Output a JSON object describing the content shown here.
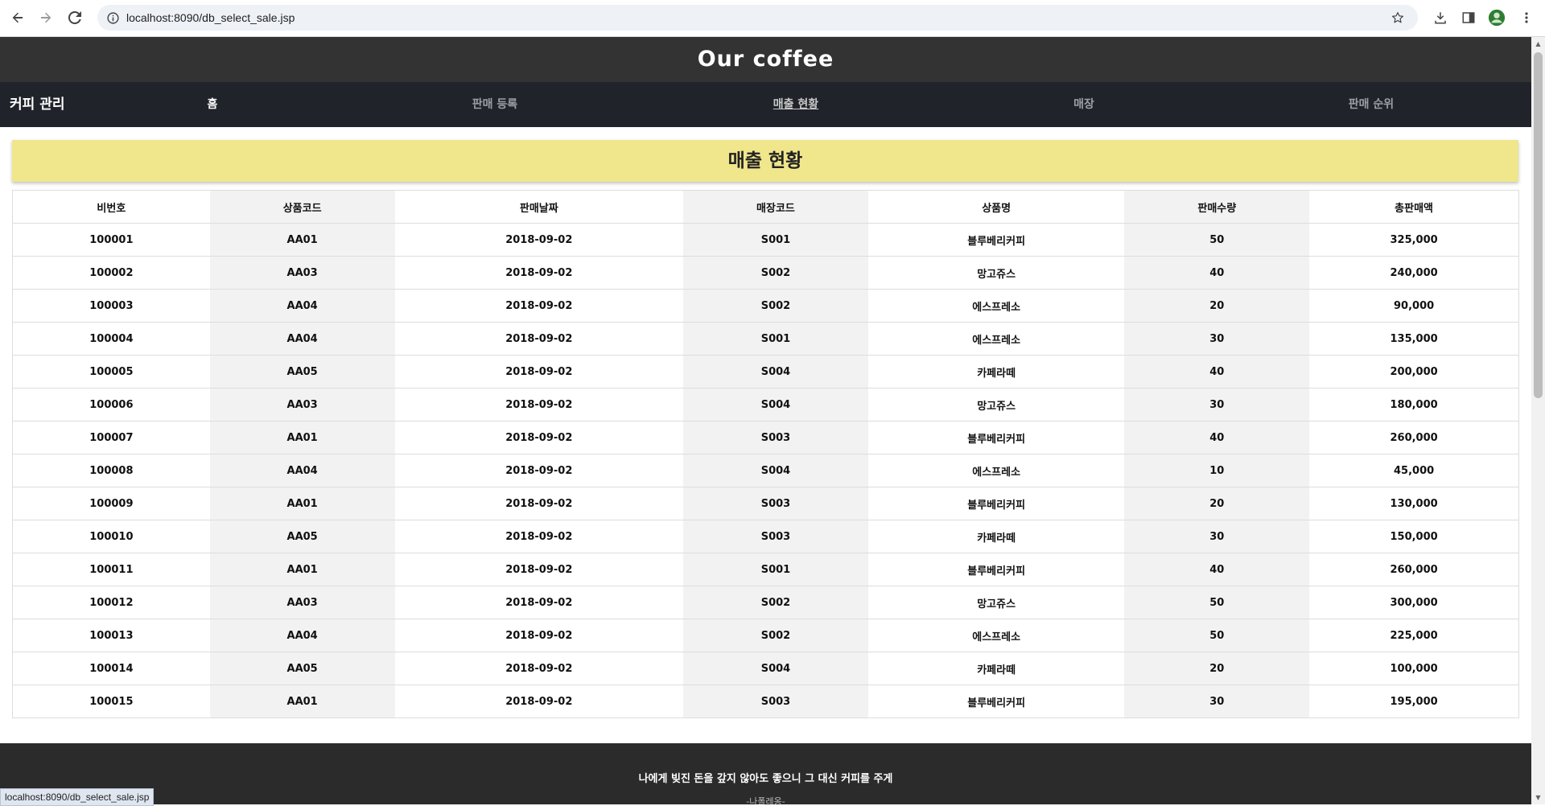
{
  "browser": {
    "url": "localhost:8090/db_select_sale.jsp",
    "status_url": "localhost:8090/db_select_sale.jsp"
  },
  "site": {
    "title": "Our coffee",
    "brand": "커피 관리",
    "nav": [
      "홈",
      "판매 등록",
      "매출 현황",
      "매장",
      "판매 순위"
    ],
    "active_nav": "매출 현황"
  },
  "banner": "매출 현황",
  "table": {
    "headers": [
      "비번호",
      "상품코드",
      "판매날짜",
      "매장코드",
      "상품명",
      "판매수량",
      "총판매액"
    ],
    "rows": [
      [
        "100001",
        "AA01",
        "2018-09-02",
        "S001",
        "블루베리커피",
        "50",
        "325,000"
      ],
      [
        "100002",
        "AA03",
        "2018-09-02",
        "S002",
        "망고쥬스",
        "40",
        "240,000"
      ],
      [
        "100003",
        "AA04",
        "2018-09-02",
        "S002",
        "에스프레소",
        "20",
        "90,000"
      ],
      [
        "100004",
        "AA04",
        "2018-09-02",
        "S001",
        "에스프레소",
        "30",
        "135,000"
      ],
      [
        "100005",
        "AA05",
        "2018-09-02",
        "S004",
        "카페라떼",
        "40",
        "200,000"
      ],
      [
        "100006",
        "AA03",
        "2018-09-02",
        "S004",
        "망고쥬스",
        "30",
        "180,000"
      ],
      [
        "100007",
        "AA01",
        "2018-09-02",
        "S003",
        "블루베리커피",
        "40",
        "260,000"
      ],
      [
        "100008",
        "AA04",
        "2018-09-02",
        "S004",
        "에스프레소",
        "10",
        "45,000"
      ],
      [
        "100009",
        "AA01",
        "2018-09-02",
        "S003",
        "블루베리커피",
        "20",
        "130,000"
      ],
      [
        "100010",
        "AA05",
        "2018-09-02",
        "S003",
        "카페라떼",
        "30",
        "150,000"
      ],
      [
        "100011",
        "AA01",
        "2018-09-02",
        "S001",
        "블루베리커피",
        "40",
        "260,000"
      ],
      [
        "100012",
        "AA03",
        "2018-09-02",
        "S002",
        "망고쥬스",
        "50",
        "300,000"
      ],
      [
        "100013",
        "AA04",
        "2018-09-02",
        "S002",
        "에스프레소",
        "50",
        "225,000"
      ],
      [
        "100014",
        "AA05",
        "2018-09-02",
        "S004",
        "카페라떼",
        "20",
        "100,000"
      ],
      [
        "100015",
        "AA01",
        "2018-09-02",
        "S003",
        "블루베리커피",
        "30",
        "195,000"
      ]
    ]
  },
  "footer": {
    "quote": "나에게 빚진 돈을 갚지 않아도 좋으니 그 대신 커피를 주게",
    "author": "-나폴레옹-"
  },
  "colors": {
    "header_bg": "#333333",
    "nav_bg": "#20242a",
    "banner_bg": "#f0e68c",
    "shaded_column": "#f2f2f2",
    "footer_bg": "#2b2b2b"
  },
  "icons": [
    "back-icon",
    "forward-icon",
    "reload-icon",
    "info-icon",
    "star-icon",
    "download-icon",
    "side-panel-icon",
    "profile-icon",
    "more-icon"
  ]
}
